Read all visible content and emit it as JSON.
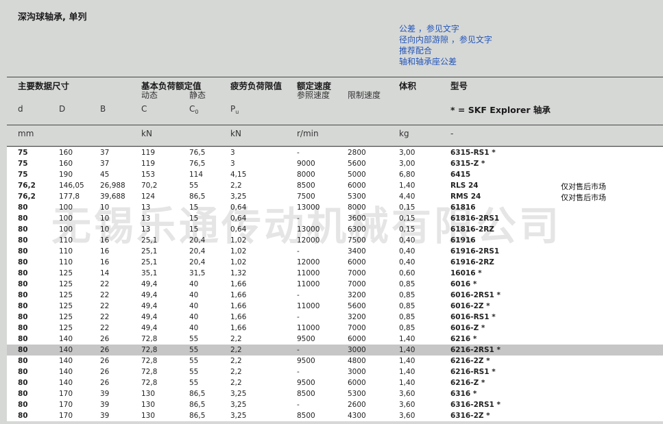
{
  "title": "深沟球轴承, 单列",
  "links": [
    "公差 ，参见文字",
    "径向内部游隙 ，参见文字",
    "推荐配合",
    "轴和轴承座公差"
  ],
  "headers": {
    "main_dims": "主要数据尺寸",
    "load_ratings": "基本负荷额定值",
    "dynamic": "动态",
    "static": "静态",
    "fatigue": "疲劳负荷限值",
    "speed": "额定速度",
    "ref_speed": "参照速度",
    "limit_speed": "限制速度",
    "volume": "体积",
    "model": "型号",
    "sym_d": "d",
    "sym_D": "D",
    "sym_B": "B",
    "sym_C": "C",
    "sym_C0": "C",
    "sym_C0_sub": "0",
    "sym_Pu": "P",
    "sym_Pu_sub": "u",
    "explorer": "* = SKF Explorer 轴承"
  },
  "units": {
    "mm": "mm",
    "kN1": "kN",
    "kN2": "kN",
    "rpm": "r/min",
    "kg": "kg",
    "dash": "-"
  },
  "watermark": "无锡乐通传动机械有限公司",
  "rows": [
    {
      "d": "75",
      "D": "160",
      "B": "37",
      "C": "119",
      "C0": "76,5",
      "Pu": "3",
      "ref": "-",
      "lim": "2800",
      "kg": "3,00",
      "des": "6315-RS1 *",
      "note": ""
    },
    {
      "d": "75",
      "D": "160",
      "B": "37",
      "C": "119",
      "C0": "76,5",
      "Pu": "3",
      "ref": "9000",
      "lim": "5600",
      "kg": "3,00",
      "des": "6315-Z *",
      "note": ""
    },
    {
      "d": "75",
      "D": "190",
      "B": "45",
      "C": "153",
      "C0": "114",
      "Pu": "4,15",
      "ref": "8000",
      "lim": "5000",
      "kg": "6,80",
      "des": "6415",
      "note": ""
    },
    {
      "d": "76,2",
      "D": "146,05",
      "B": "26,988",
      "C": "70,2",
      "C0": "55",
      "Pu": "2,2",
      "ref": "8500",
      "lim": "6000",
      "kg": "1,40",
      "des": "RLS 24",
      "note": "仅对售后市场"
    },
    {
      "d": "76,2",
      "D": "177,8",
      "B": "39,688",
      "C": "124",
      "C0": "86,5",
      "Pu": "3,25",
      "ref": "7500",
      "lim": "5300",
      "kg": "4,40",
      "des": "RMS 24",
      "note": "仅对售后市场"
    },
    {
      "d": "80",
      "D": "100",
      "B": "10",
      "C": "13",
      "C0": "15",
      "Pu": "0,64",
      "ref": "13000",
      "lim": "8000",
      "kg": "0,15",
      "des": "61816",
      "note": ""
    },
    {
      "d": "80",
      "D": "100",
      "B": "10",
      "C": "13",
      "C0": "15",
      "Pu": "0,64",
      "ref": "-",
      "lim": "3600",
      "kg": "0,15",
      "des": "61816-2RS1",
      "note": ""
    },
    {
      "d": "80",
      "D": "100",
      "B": "10",
      "C": "13",
      "C0": "15",
      "Pu": "0,64",
      "ref": "13000",
      "lim": "6300",
      "kg": "0,15",
      "des": "61816-2RZ",
      "note": ""
    },
    {
      "d": "80",
      "D": "110",
      "B": "16",
      "C": "25,1",
      "C0": "20,4",
      "Pu": "1,02",
      "ref": "12000",
      "lim": "7500",
      "kg": "0,40",
      "des": "61916",
      "note": ""
    },
    {
      "d": "80",
      "D": "110",
      "B": "16",
      "C": "25,1",
      "C0": "20,4",
      "Pu": "1,02",
      "ref": "-",
      "lim": "3400",
      "kg": "0,40",
      "des": "61916-2RS1",
      "note": ""
    },
    {
      "d": "80",
      "D": "110",
      "B": "16",
      "C": "25,1",
      "C0": "20,4",
      "Pu": "1,02",
      "ref": "12000",
      "lim": "6000",
      "kg": "0,40",
      "des": "61916-2RZ",
      "note": ""
    },
    {
      "d": "80",
      "D": "125",
      "B": "14",
      "C": "35,1",
      "C0": "31,5",
      "Pu": "1,32",
      "ref": "11000",
      "lim": "7000",
      "kg": "0,60",
      "des": "16016 *",
      "note": ""
    },
    {
      "d": "80",
      "D": "125",
      "B": "22",
      "C": "49,4",
      "C0": "40",
      "Pu": "1,66",
      "ref": "11000",
      "lim": "7000",
      "kg": "0,85",
      "des": "6016 *",
      "note": ""
    },
    {
      "d": "80",
      "D": "125",
      "B": "22",
      "C": "49,4",
      "C0": "40",
      "Pu": "1,66",
      "ref": "-",
      "lim": "3200",
      "kg": "0,85",
      "des": "6016-2RS1 *",
      "note": ""
    },
    {
      "d": "80",
      "D": "125",
      "B": "22",
      "C": "49,4",
      "C0": "40",
      "Pu": "1,66",
      "ref": "11000",
      "lim": "5600",
      "kg": "0,85",
      "des": "6016-2Z *",
      "note": ""
    },
    {
      "d": "80",
      "D": "125",
      "B": "22",
      "C": "49,4",
      "C0": "40",
      "Pu": "1,66",
      "ref": "-",
      "lim": "3200",
      "kg": "0,85",
      "des": "6016-RS1 *",
      "note": ""
    },
    {
      "d": "80",
      "D": "125",
      "B": "22",
      "C": "49,4",
      "C0": "40",
      "Pu": "1,66",
      "ref": "11000",
      "lim": "7000",
      "kg": "0,85",
      "des": "6016-Z *",
      "note": ""
    },
    {
      "d": "80",
      "D": "140",
      "B": "26",
      "C": "72,8",
      "C0": "55",
      "Pu": "2,2",
      "ref": "9500",
      "lim": "6000",
      "kg": "1,40",
      "des": "6216 *",
      "note": ""
    },
    {
      "d": "80",
      "D": "140",
      "B": "26",
      "C": "72,8",
      "C0": "55",
      "Pu": "2,2",
      "ref": "-",
      "lim": "3000",
      "kg": "1,40",
      "des": "6216-2RS1 *",
      "note": "",
      "hl": true
    },
    {
      "d": "80",
      "D": "140",
      "B": "26",
      "C": "72,8",
      "C0": "55",
      "Pu": "2,2",
      "ref": "9500",
      "lim": "4800",
      "kg": "1,40",
      "des": "6216-2Z *",
      "note": ""
    },
    {
      "d": "80",
      "D": "140",
      "B": "26",
      "C": "72,8",
      "C0": "55",
      "Pu": "2,2",
      "ref": "-",
      "lim": "3000",
      "kg": "1,40",
      "des": "6216-RS1 *",
      "note": ""
    },
    {
      "d": "80",
      "D": "140",
      "B": "26",
      "C": "72,8",
      "C0": "55",
      "Pu": "2,2",
      "ref": "9500",
      "lim": "6000",
      "kg": "1,40",
      "des": "6216-Z *",
      "note": ""
    },
    {
      "d": "80",
      "D": "170",
      "B": "39",
      "C": "130",
      "C0": "86,5",
      "Pu": "3,25",
      "ref": "8500",
      "lim": "5300",
      "kg": "3,60",
      "des": "6316 *",
      "note": ""
    },
    {
      "d": "80",
      "D": "170",
      "B": "39",
      "C": "130",
      "C0": "86,5",
      "Pu": "3,25",
      "ref": "-",
      "lim": "2600",
      "kg": "3,60",
      "des": "6316-2RS1 *",
      "note": ""
    },
    {
      "d": "80",
      "D": "170",
      "B": "39",
      "C": "130",
      "C0": "86,5",
      "Pu": "3,25",
      "ref": "8500",
      "lim": "4300",
      "kg": "3,60",
      "des": "6316-2Z *",
      "note": ""
    }
  ]
}
